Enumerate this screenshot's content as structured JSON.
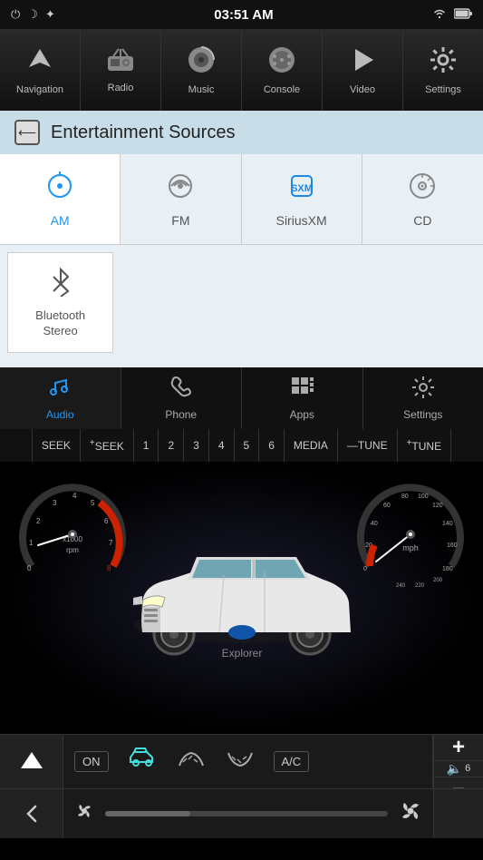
{
  "statusBar": {
    "time": "03:51 AM",
    "icons": {
      "power": "⏻",
      "moon": "☾",
      "sun": "✦",
      "wifi": "▲",
      "battery": "▭"
    }
  },
  "navBar": {
    "items": [
      {
        "id": "navigation",
        "label": "Navigation",
        "icon": "▶"
      },
      {
        "id": "radio",
        "label": "Radio",
        "icon": "📻"
      },
      {
        "id": "music",
        "label": "Music",
        "icon": "🎵"
      },
      {
        "id": "console",
        "label": "Console",
        "icon": "🎮"
      },
      {
        "id": "video",
        "label": "Video",
        "icon": "▶"
      },
      {
        "id": "settings",
        "label": "Settings",
        "icon": "⚙"
      }
    ]
  },
  "entertainmentSources": {
    "title": "Entertainment Sources",
    "backLabel": "←",
    "sources": [
      {
        "id": "am",
        "label": "AM",
        "active": true
      },
      {
        "id": "fm",
        "label": "FM",
        "active": false
      },
      {
        "id": "sirius",
        "label": "SiriusXM",
        "active": false
      },
      {
        "id": "cd",
        "label": "CD",
        "active": false
      }
    ],
    "bluetooth": {
      "label": "Bluetooth\nStereo"
    }
  },
  "tabs": [
    {
      "id": "audio",
      "label": "Audio",
      "active": true
    },
    {
      "id": "phone",
      "label": "Phone",
      "active": false
    },
    {
      "id": "apps",
      "label": "Apps",
      "active": false
    },
    {
      "id": "settings",
      "label": "Settings",
      "active": false
    }
  ],
  "seekBar": {
    "seek": "SEEK",
    "seekPlus": "SEEK",
    "channels": [
      "1",
      "2",
      "3",
      "4",
      "5",
      "6"
    ],
    "media": "MEDIA",
    "tune": "TUNE",
    "tunePlus": "TUNE"
  },
  "carDisplay": {
    "carName": "Explorer",
    "leftGauge": {
      "labels": [
        "0",
        "1",
        "2",
        "3",
        "4",
        "5",
        "6",
        "7",
        "8"
      ],
      "subLabel": "x1000\nrpm",
      "value": 1.5
    },
    "rightGauge": {
      "labels": [
        "0",
        "20",
        "40",
        "60",
        "80",
        "100",
        "120",
        "140",
        "160",
        "180",
        "200",
        "220",
        "240"
      ],
      "subLabel": "mph",
      "value": 0
    }
  },
  "climate": {
    "onLabel": "ON",
    "acLabel": "A/C",
    "fanIconLeft": "❄",
    "fanIconRight": "❄",
    "volLabel": "6",
    "plusLabel": "+",
    "minusLabel": "—"
  }
}
